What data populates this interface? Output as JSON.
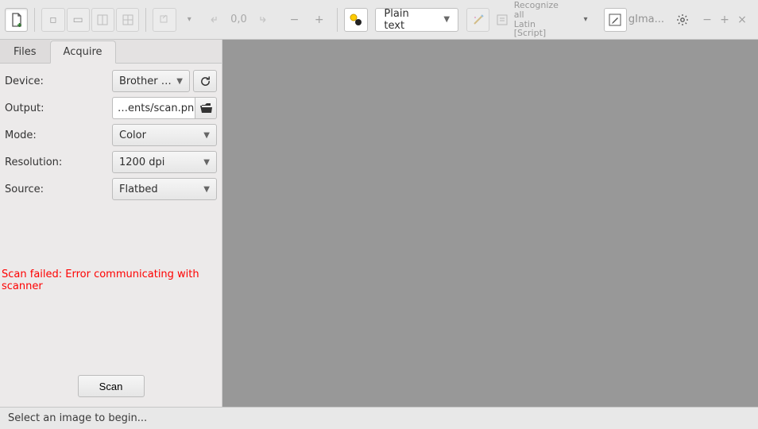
{
  "title": "gIma...",
  "toolbar": {
    "coords": "0,0",
    "plain_text": "Plain text",
    "recognize_line1": "Recognize all",
    "recognize_line2": "Latin [Script]"
  },
  "tabs": {
    "files": "Files",
    "acquire": "Acquire"
  },
  "form": {
    "device_label": "Device:",
    "device_value": "Brother …",
    "output_label": "Output:",
    "output_value": "…ents/scan.png",
    "mode_label": "Mode:",
    "mode_value": "Color",
    "resolution_label": "Resolution:",
    "resolution_value": "1200 dpi",
    "source_label": "Source:",
    "source_value": "Flatbed"
  },
  "error": "Scan failed: Error communicating with scanner",
  "scan_label": "Scan",
  "status": "Select an image to begin..."
}
